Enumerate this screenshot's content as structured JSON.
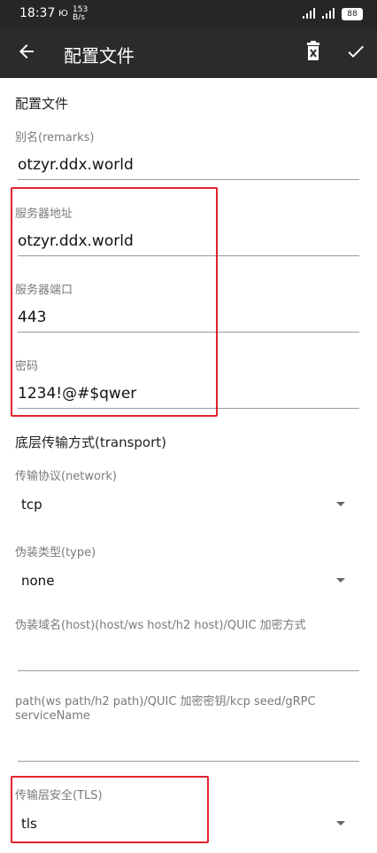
{
  "status": {
    "time": "18:37",
    "net_speed_top": "153",
    "net_speed_bottom": "B/s",
    "battery": "88"
  },
  "appbar": {
    "title": "配置文件"
  },
  "sections": {
    "profile": "配置文件",
    "transport": "底层传输方式(transport)"
  },
  "fields": {
    "remarks": {
      "label": "别名(remarks)",
      "value": "otzyr.ddx.world"
    },
    "address": {
      "label": "服务器地址",
      "value": "otzyr.ddx.world"
    },
    "port": {
      "label": "服务器端口",
      "value": "443"
    },
    "password": {
      "label": "密码",
      "value": "1234!@#$qwer"
    },
    "network": {
      "label": "传输协议(network)",
      "value": "tcp"
    },
    "type": {
      "label": "伪装类型(type)",
      "value": "none"
    },
    "host": {
      "label": "伪装域名(host)(host/ws host/h2 host)/QUIC 加密方式",
      "value": ""
    },
    "path": {
      "label": "path(ws path/h2 path)/QUIC 加密密钥/kcp seed/gRPC serviceName",
      "value": ""
    },
    "tls": {
      "label": "传输层安全(TLS)",
      "value": "tls"
    }
  },
  "icons": {
    "back": "arrow-back-icon",
    "delete": "delete-icon",
    "save": "check-icon"
  },
  "colors": {
    "highlight": "#e0232d",
    "appbar": "#2b2b2b"
  }
}
